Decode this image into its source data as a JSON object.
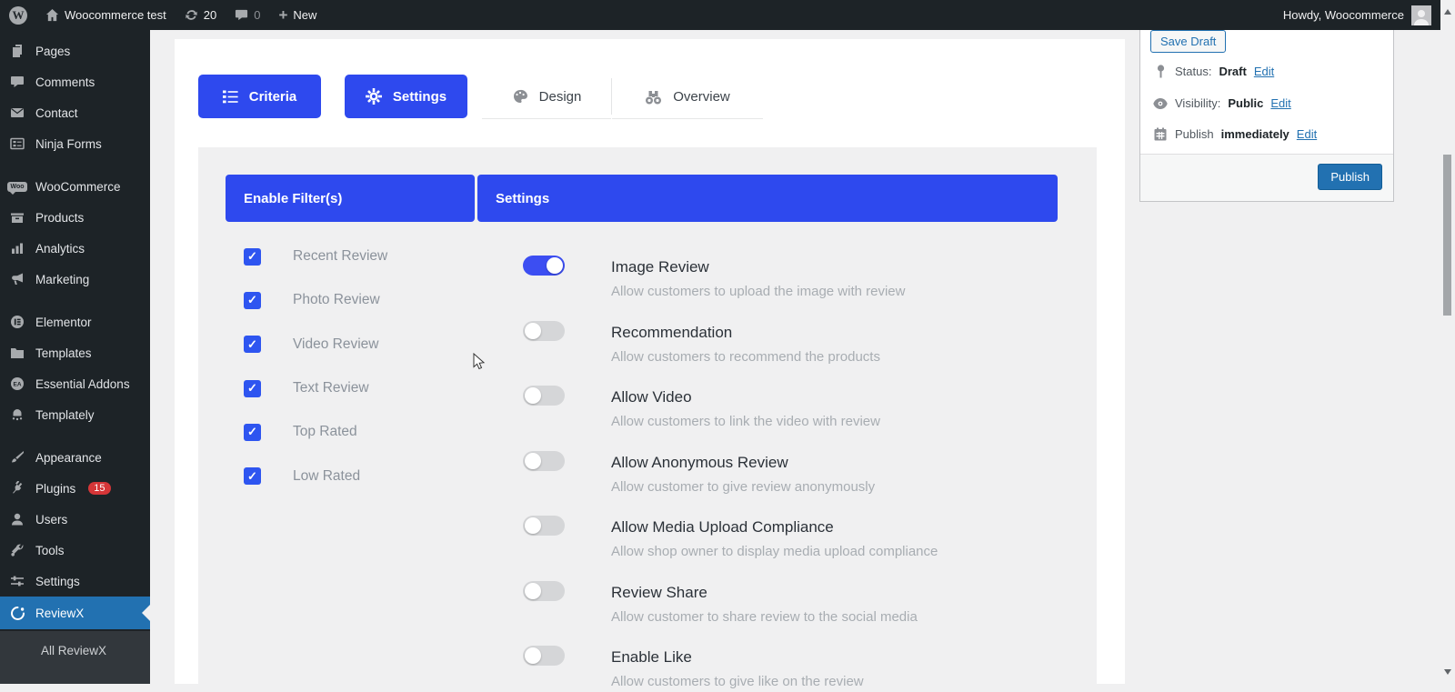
{
  "colors": {
    "accent_blue": "#2e49ee",
    "toggle_on_blue": "#3c4ef2",
    "checkbox_blue": "#2e55f0",
    "wp_link_blue": "#2271b1",
    "badge_red": "#d63638",
    "sidebar_bg": "#1d2327",
    "content_bg": "#f0f0f1"
  },
  "admin_bar": {
    "site_name": "Woocommerce test",
    "updates_count": "20",
    "comments_count": "0",
    "new_label": "New",
    "howdy": "Howdy, Woocommerce"
  },
  "sidebar": {
    "items": [
      {
        "label": "Pages",
        "icon": "pages-icon"
      },
      {
        "label": "Comments",
        "icon": "comments-icon"
      },
      {
        "label": "Contact",
        "icon": "contact-icon"
      },
      {
        "label": "Ninja Forms",
        "icon": "ninja-forms-icon"
      },
      {
        "label": "WooCommerce",
        "icon": "woocommerce-icon"
      },
      {
        "label": "Products",
        "icon": "products-icon"
      },
      {
        "label": "Analytics",
        "icon": "analytics-icon"
      },
      {
        "label": "Marketing",
        "icon": "marketing-icon"
      },
      {
        "label": "Elementor",
        "icon": "elementor-icon"
      },
      {
        "label": "Templates",
        "icon": "templates-icon"
      },
      {
        "label": "Essential Addons",
        "icon": "essential-addons-icon"
      },
      {
        "label": "Templately",
        "icon": "templately-icon"
      },
      {
        "label": "Appearance",
        "icon": "appearance-icon"
      },
      {
        "label": "Plugins",
        "icon": "plugins-icon",
        "badge": "15"
      },
      {
        "label": "Users",
        "icon": "users-icon"
      },
      {
        "label": "Tools",
        "icon": "tools-icon"
      },
      {
        "label": "Settings",
        "icon": "settings-icon"
      },
      {
        "label": "ReviewX",
        "icon": "reviewx-icon",
        "active": true
      }
    ],
    "submenu": [
      {
        "label": "All ReviewX"
      }
    ]
  },
  "tabs": [
    {
      "label": "Criteria",
      "icon": "criteria-list-icon",
      "active": true
    },
    {
      "label": "Settings",
      "icon": "gear-icon",
      "active": true
    },
    {
      "label": "Design",
      "icon": "palette-icon",
      "active": false
    },
    {
      "label": "Overview",
      "icon": "binoculars-icon",
      "active": false
    }
  ],
  "table": {
    "enable_filters_header": "Enable Filter(s)",
    "settings_header": "Settings",
    "filters": [
      {
        "label": "Recent Review",
        "checked": true
      },
      {
        "label": "Photo Review",
        "checked": true
      },
      {
        "label": "Video Review",
        "checked": true
      },
      {
        "label": "Text Review",
        "checked": true
      },
      {
        "label": "Top Rated",
        "checked": true
      },
      {
        "label": "Low Rated",
        "checked": true
      }
    ],
    "settings": [
      {
        "title": "Image Review",
        "description": "Allow customers to upload the image with review",
        "enabled": true
      },
      {
        "title": "Recommendation",
        "description": "Allow customers to recommend the products",
        "enabled": false
      },
      {
        "title": "Allow Video",
        "description": "Allow customers to link the video with review",
        "enabled": false
      },
      {
        "title": "Allow Anonymous Review",
        "description": "Allow customer to give review anonymously",
        "enabled": false
      },
      {
        "title": "Allow Media Upload Compliance",
        "description": "Allow shop owner to display media upload compliance",
        "enabled": false
      },
      {
        "title": "Review Share",
        "description": "Allow customer to share review to the social media",
        "enabled": false
      },
      {
        "title": "Enable Like",
        "description": "Allow customers to give like on the review",
        "enabled": false
      }
    ]
  },
  "publish_box": {
    "save_draft_label": "Save Draft",
    "status_label": "Status:",
    "status_value": "Draft",
    "visibility_label": "Visibility:",
    "visibility_value": "Public",
    "schedule_label": "Publish",
    "schedule_value": "immediately",
    "edit_label": "Edit",
    "publish_label": "Publish"
  },
  "checkmark": "✓"
}
